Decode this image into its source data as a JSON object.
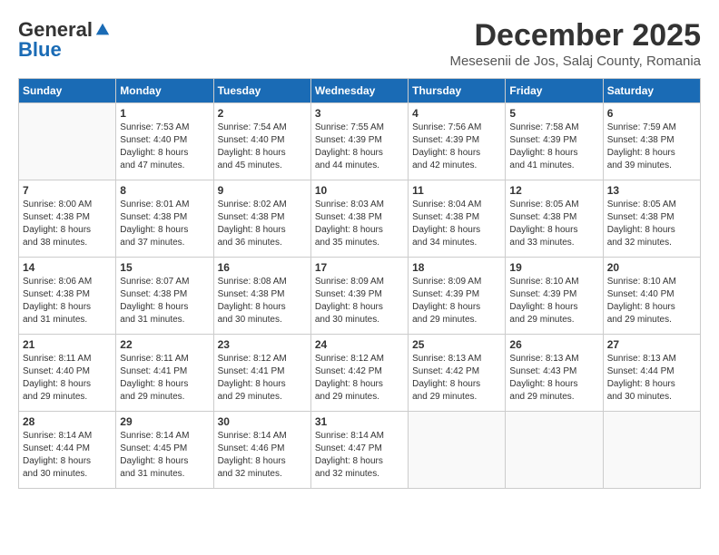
{
  "logo": {
    "general": "General",
    "blue": "Blue"
  },
  "title": "December 2025",
  "location": "Mesesenii de Jos, Salaj County, Romania",
  "headers": [
    "Sunday",
    "Monday",
    "Tuesday",
    "Wednesday",
    "Thursday",
    "Friday",
    "Saturday"
  ],
  "weeks": [
    [
      {
        "day": "",
        "info": ""
      },
      {
        "day": "1",
        "info": "Sunrise: 7:53 AM\nSunset: 4:40 PM\nDaylight: 8 hours\nand 47 minutes."
      },
      {
        "day": "2",
        "info": "Sunrise: 7:54 AM\nSunset: 4:40 PM\nDaylight: 8 hours\nand 45 minutes."
      },
      {
        "day": "3",
        "info": "Sunrise: 7:55 AM\nSunset: 4:39 PM\nDaylight: 8 hours\nand 44 minutes."
      },
      {
        "day": "4",
        "info": "Sunrise: 7:56 AM\nSunset: 4:39 PM\nDaylight: 8 hours\nand 42 minutes."
      },
      {
        "day": "5",
        "info": "Sunrise: 7:58 AM\nSunset: 4:39 PM\nDaylight: 8 hours\nand 41 minutes."
      },
      {
        "day": "6",
        "info": "Sunrise: 7:59 AM\nSunset: 4:38 PM\nDaylight: 8 hours\nand 39 minutes."
      }
    ],
    [
      {
        "day": "7",
        "info": "Sunrise: 8:00 AM\nSunset: 4:38 PM\nDaylight: 8 hours\nand 38 minutes."
      },
      {
        "day": "8",
        "info": "Sunrise: 8:01 AM\nSunset: 4:38 PM\nDaylight: 8 hours\nand 37 minutes."
      },
      {
        "day": "9",
        "info": "Sunrise: 8:02 AM\nSunset: 4:38 PM\nDaylight: 8 hours\nand 36 minutes."
      },
      {
        "day": "10",
        "info": "Sunrise: 8:03 AM\nSunset: 4:38 PM\nDaylight: 8 hours\nand 35 minutes."
      },
      {
        "day": "11",
        "info": "Sunrise: 8:04 AM\nSunset: 4:38 PM\nDaylight: 8 hours\nand 34 minutes."
      },
      {
        "day": "12",
        "info": "Sunrise: 8:05 AM\nSunset: 4:38 PM\nDaylight: 8 hours\nand 33 minutes."
      },
      {
        "day": "13",
        "info": "Sunrise: 8:05 AM\nSunset: 4:38 PM\nDaylight: 8 hours\nand 32 minutes."
      }
    ],
    [
      {
        "day": "14",
        "info": "Sunrise: 8:06 AM\nSunset: 4:38 PM\nDaylight: 8 hours\nand 31 minutes."
      },
      {
        "day": "15",
        "info": "Sunrise: 8:07 AM\nSunset: 4:38 PM\nDaylight: 8 hours\nand 31 minutes."
      },
      {
        "day": "16",
        "info": "Sunrise: 8:08 AM\nSunset: 4:38 PM\nDaylight: 8 hours\nand 30 minutes."
      },
      {
        "day": "17",
        "info": "Sunrise: 8:09 AM\nSunset: 4:39 PM\nDaylight: 8 hours\nand 30 minutes."
      },
      {
        "day": "18",
        "info": "Sunrise: 8:09 AM\nSunset: 4:39 PM\nDaylight: 8 hours\nand 29 minutes."
      },
      {
        "day": "19",
        "info": "Sunrise: 8:10 AM\nSunset: 4:39 PM\nDaylight: 8 hours\nand 29 minutes."
      },
      {
        "day": "20",
        "info": "Sunrise: 8:10 AM\nSunset: 4:40 PM\nDaylight: 8 hours\nand 29 minutes."
      }
    ],
    [
      {
        "day": "21",
        "info": "Sunrise: 8:11 AM\nSunset: 4:40 PM\nDaylight: 8 hours\nand 29 minutes."
      },
      {
        "day": "22",
        "info": "Sunrise: 8:11 AM\nSunset: 4:41 PM\nDaylight: 8 hours\nand 29 minutes."
      },
      {
        "day": "23",
        "info": "Sunrise: 8:12 AM\nSunset: 4:41 PM\nDaylight: 8 hours\nand 29 minutes."
      },
      {
        "day": "24",
        "info": "Sunrise: 8:12 AM\nSunset: 4:42 PM\nDaylight: 8 hours\nand 29 minutes."
      },
      {
        "day": "25",
        "info": "Sunrise: 8:13 AM\nSunset: 4:42 PM\nDaylight: 8 hours\nand 29 minutes."
      },
      {
        "day": "26",
        "info": "Sunrise: 8:13 AM\nSunset: 4:43 PM\nDaylight: 8 hours\nand 29 minutes."
      },
      {
        "day": "27",
        "info": "Sunrise: 8:13 AM\nSunset: 4:44 PM\nDaylight: 8 hours\nand 30 minutes."
      }
    ],
    [
      {
        "day": "28",
        "info": "Sunrise: 8:14 AM\nSunset: 4:44 PM\nDaylight: 8 hours\nand 30 minutes."
      },
      {
        "day": "29",
        "info": "Sunrise: 8:14 AM\nSunset: 4:45 PM\nDaylight: 8 hours\nand 31 minutes."
      },
      {
        "day": "30",
        "info": "Sunrise: 8:14 AM\nSunset: 4:46 PM\nDaylight: 8 hours\nand 32 minutes."
      },
      {
        "day": "31",
        "info": "Sunrise: 8:14 AM\nSunset: 4:47 PM\nDaylight: 8 hours\nand 32 minutes."
      },
      {
        "day": "",
        "info": ""
      },
      {
        "day": "",
        "info": ""
      },
      {
        "day": "",
        "info": ""
      }
    ]
  ]
}
